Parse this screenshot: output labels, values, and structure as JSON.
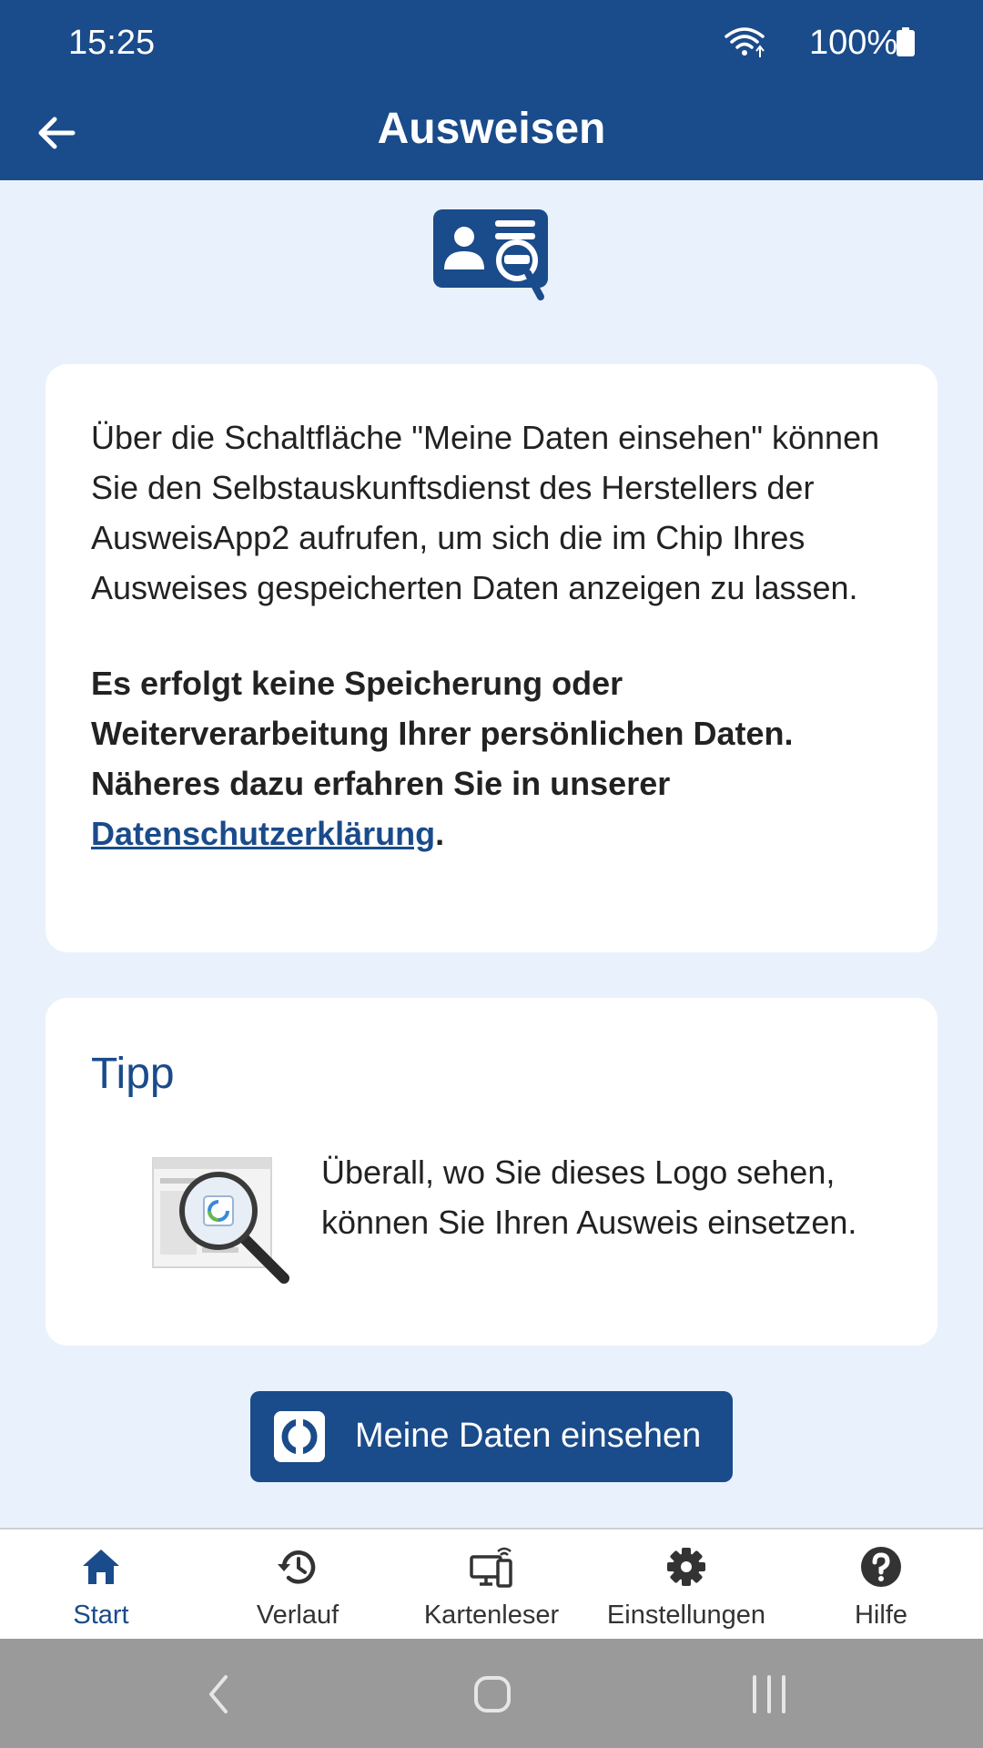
{
  "status": {
    "time": "15:25",
    "battery": "100%",
    "wifi_icon": "wifi-icon",
    "battery_icon": "battery-icon"
  },
  "appbar": {
    "title": "Ausweisen",
    "back_icon": "arrow-back-icon"
  },
  "intro": {
    "paragraph": "Über die Schaltfläche \"Meine Daten einsehen\" können Sie den Selbstauskunftsdienst des Herstellers der AusweisApp2 aufrufen, um sich die im Chip Ihres Ausweises gespeicherten Daten anzeigen zu lassen.",
    "bold_text": "Es erfolgt keine Speicherung oder Weiterverarbeitung Ihrer persönlichen Daten. Näheres dazu erfahren Sie in unserer ",
    "privacy_link": "Datenschutzerklärung",
    "period": "."
  },
  "tip": {
    "title": "Tipp",
    "text": "Überall, wo Sie dieses Logo sehen, können Sie Ihren Ausweis einsetzen."
  },
  "primary_button": {
    "label": "Meine Daten einsehen"
  },
  "bottom_nav": [
    {
      "label": "Start",
      "icon": "home-icon",
      "active": true
    },
    {
      "label": "Verlauf",
      "icon": "history-icon",
      "active": false
    },
    {
      "label": "Kartenleser",
      "icon": "card-reader-icon",
      "active": false
    },
    {
      "label": "Einstellungen",
      "icon": "gear-icon",
      "active": false
    },
    {
      "label": "Hilfe",
      "icon": "help-icon",
      "active": false
    }
  ],
  "colors": {
    "primary": "#1a4b8b",
    "background": "#e9f2fc",
    "card": "#ffffff",
    "system_nav": "#9a9a9a"
  }
}
